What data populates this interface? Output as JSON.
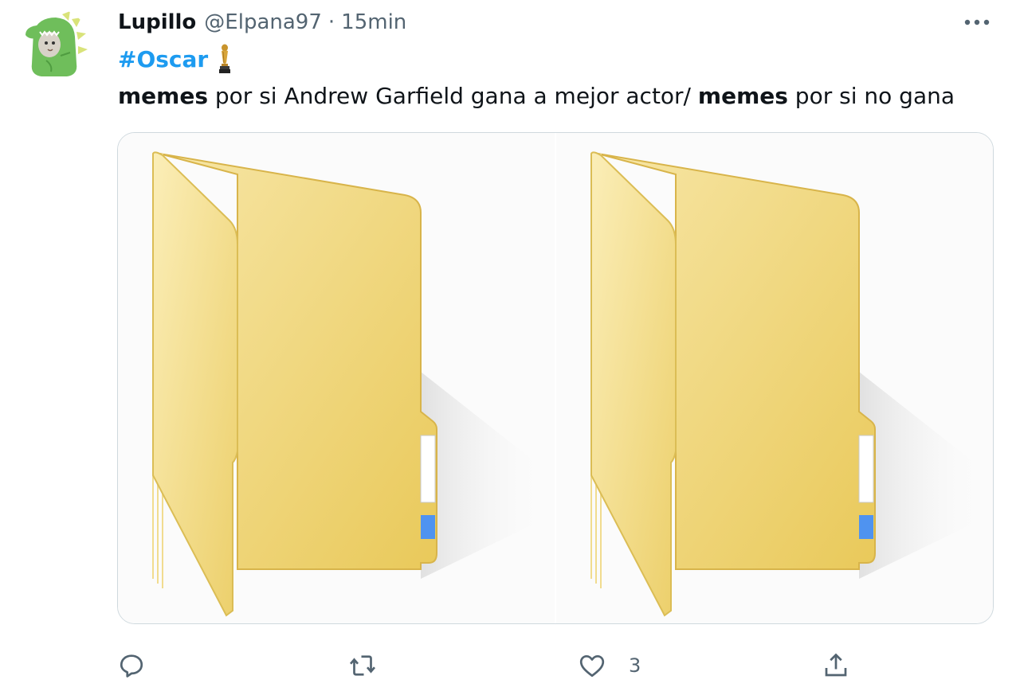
{
  "tweet": {
    "author": {
      "display_name": "Lupillo",
      "handle": "@Elpana97",
      "avatar_icon": "dinosaur-costume-avatar"
    },
    "separator": "·",
    "time": "15min",
    "hashtag": "#Oscar",
    "hashtag_emoji": "trophy-icon",
    "text": {
      "part1_bold": "memes",
      "part2": " por si Andrew Garfield gana a mejor actor/ ",
      "part3_bold": "memes",
      "part4": " por si no gana"
    },
    "media": [
      {
        "icon": "folder-icon"
      },
      {
        "icon": "folder-icon"
      }
    ],
    "actions": {
      "reply_icon": "reply-icon",
      "retweet_icon": "retweet-icon",
      "like_icon": "heart-icon",
      "like_count": "3",
      "share_icon": "share-icon"
    },
    "more_icon": "more-icon"
  },
  "colors": {
    "link": "#1d9bf0",
    "secondary_text": "#536471",
    "primary_text": "#0f1419",
    "border": "#cfd9de",
    "folder": "#f3d67a"
  }
}
